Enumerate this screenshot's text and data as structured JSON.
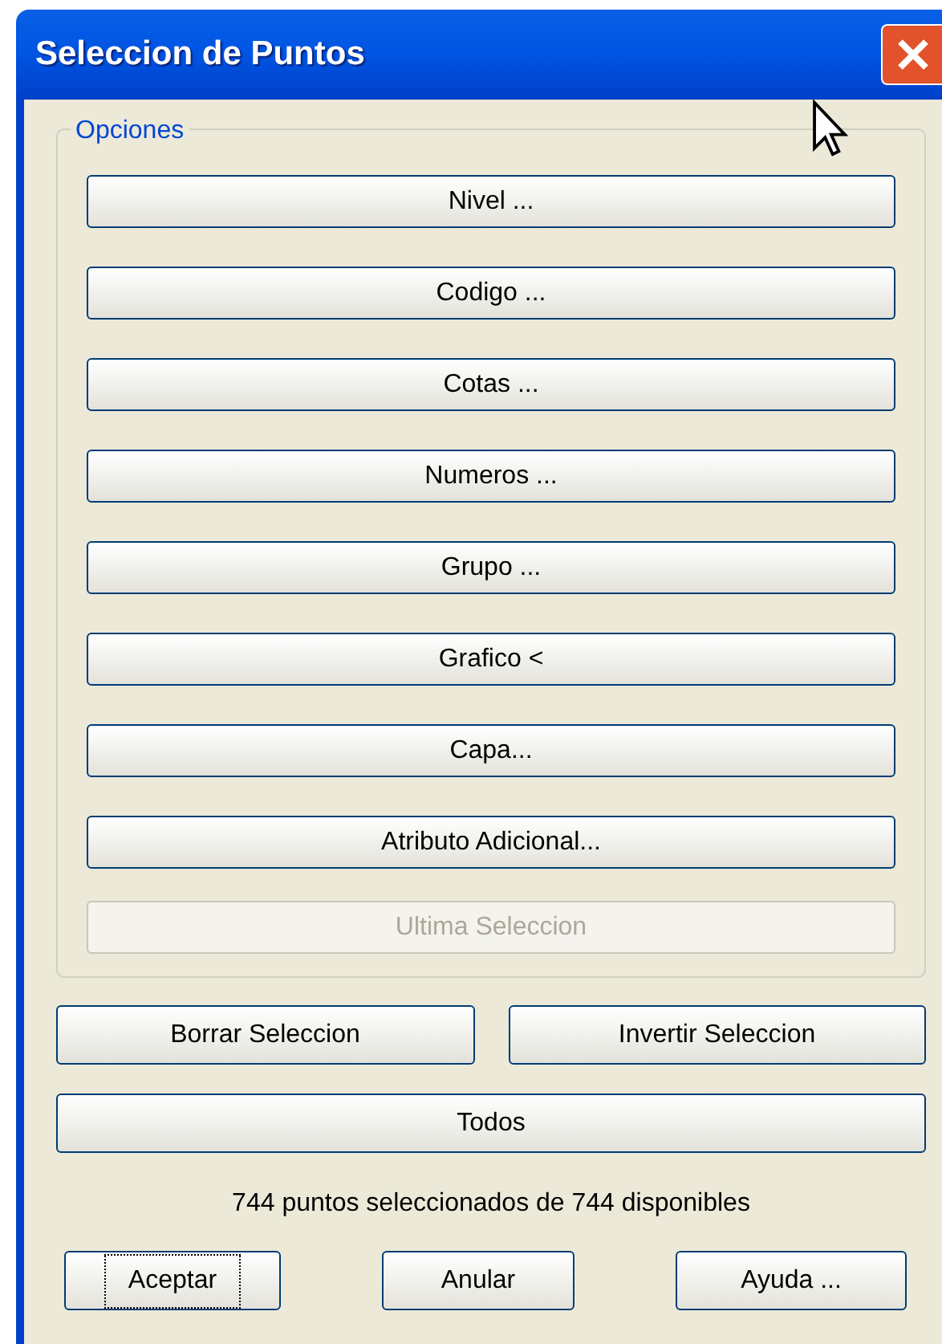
{
  "window": {
    "title": "Seleccion de Puntos"
  },
  "options": {
    "legend": "Opciones",
    "buttons": [
      {
        "label": "Nivel ...",
        "disabled": false
      },
      {
        "label": "Codigo ...",
        "disabled": false
      },
      {
        "label": "Cotas ...",
        "disabled": false
      },
      {
        "label": "Numeros ...",
        "disabled": false
      },
      {
        "label": "Grupo ...",
        "disabled": false
      },
      {
        "label": "Grafico <",
        "disabled": false
      },
      {
        "label": "Capa...",
        "disabled": false
      },
      {
        "label": "Atributo Adicional...",
        "disabled": false
      },
      {
        "label": "Ultima Seleccion",
        "disabled": true
      }
    ]
  },
  "selection_buttons": [
    {
      "label": "Borrar Seleccion"
    },
    {
      "label": "Invertir Seleccion"
    }
  ],
  "all_button": {
    "label": "Todos"
  },
  "status": "744 puntos seleccionados de 744 disponibles",
  "dialog_buttons": [
    {
      "label": "Aceptar",
      "focused": true
    },
    {
      "label": "Anular",
      "focused": false
    },
    {
      "label": "Ayuda ...",
      "focused": false
    }
  ]
}
